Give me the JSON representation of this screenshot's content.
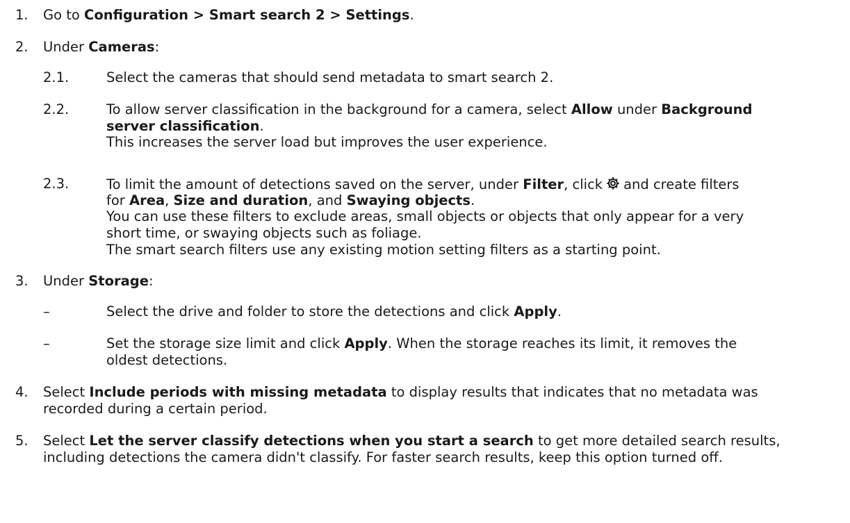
{
  "items": [
    {
      "num": "1.",
      "parts": [
        "Go to ",
        "Configuration > Smart search 2 > Settings",
        "."
      ]
    },
    {
      "num": "2.",
      "parts": [
        "Under ",
        "Cameras",
        ":"
      ],
      "sub": [
        {
          "num": "2.1.",
          "text": "Select the cameras that should send metadata to smart search 2."
        },
        {
          "num": "2.2.",
          "l1": [
            "To allow server classification in the background for a camera, select ",
            "Allow",
            " under ",
            "Background"
          ],
          "l2": [
            "server classification",
            "."
          ],
          "l3": "This increases the server load but improves the user experience."
        },
        {
          "num": "2.3.",
          "l1": [
            "To limit the amount of detections saved on the server, under ",
            "Filter",
            ", click",
            "and create filters"
          ],
          "l1_icon": "gear-icon",
          "l2": [
            "for ",
            "Area",
            ", ",
            "Size and duration",
            ", and ",
            "Swaying objects",
            "."
          ],
          "l3": "You can use these filters to exclude areas, small objects or objects that only appear for a very",
          "l4": "short time, or swaying objects such as foliage.",
          "l5": "The smart search filters use any existing motion setting filters as a starting point."
        }
      ]
    },
    {
      "num": "3.",
      "parts": [
        "Under ",
        "Storage",
        ":"
      ],
      "sub": [
        {
          "bullet": "–",
          "parts": [
            "Select the drive and folder to store the detections and click ",
            "Apply",
            "."
          ]
        },
        {
          "bullet": "–",
          "l1": [
            "Set the storage size limit and click ",
            "Apply",
            ". When the storage reaches its limit, it removes the"
          ],
          "l2": "oldest detections."
        }
      ]
    },
    {
      "num": "4.",
      "l1": [
        "Select ",
        "Include periods with missing metadata",
        " to display results that indicates that no metadata was"
      ],
      "l2": "recorded during a certain period."
    },
    {
      "num": "5.",
      "l1": [
        "Select ",
        "Let the server classify detections when you start a search",
        " to get more detailed search results,"
      ],
      "l2": "including detections the camera didn't classify. For faster search results, keep this option turned off."
    }
  ]
}
